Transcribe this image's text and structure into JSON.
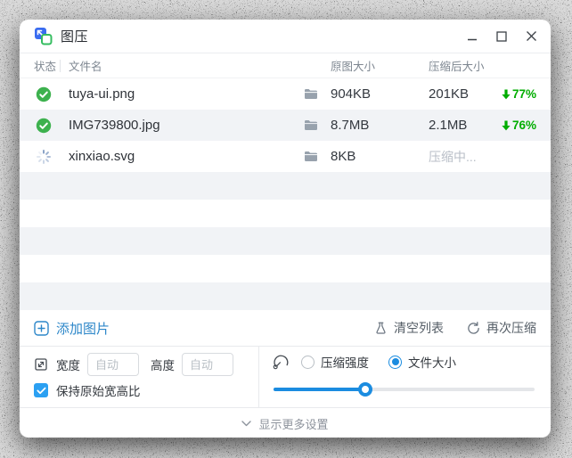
{
  "window": {
    "title": "图压"
  },
  "icons": {
    "app_logo": "overlapping-blue-green-squares",
    "minimize": "horizontal-line",
    "maximize": "square-outline",
    "close": "x-cross",
    "status_done": "green-check-circle",
    "status_processing": "segmented-spinner",
    "folder": "folder",
    "reduction": "green-down-arrow",
    "add": "plus-square",
    "clear": "flask",
    "recompress": "refresh-arrow",
    "resize": "square-diagonal-arrow",
    "gauge": "speedometer",
    "more": "chevron-down"
  },
  "table": {
    "columns": [
      "状态",
      "文件名",
      "原图大小",
      "压缩后大小"
    ],
    "rows": [
      {
        "status": "done",
        "filename": "tuya-ui.png",
        "original_size": "904KB",
        "compressed_size": "201KB",
        "reduction": "77%"
      },
      {
        "status": "done",
        "filename": "IMG739800.jpg",
        "original_size": "8.7MB",
        "compressed_size": "2.1MB",
        "reduction": "76%"
      },
      {
        "status": "compressing",
        "filename": "xinxiao.svg",
        "original_size": "8KB",
        "compressed_size": "压缩中...",
        "reduction": ""
      }
    ]
  },
  "toolbar": {
    "add_label": "添加图片",
    "clear_label": "清空列表",
    "recompress_label": "再次压缩"
  },
  "settings": {
    "width_label": "宽度",
    "height_label": "高度",
    "width_placeholder": "自动",
    "height_placeholder": "自动",
    "width_value": "",
    "height_value": "",
    "keep_ratio_label": "保持原始宽高比",
    "keep_ratio_checked": true,
    "mode_options": [
      "压缩强度",
      "文件大小"
    ],
    "mode_selected": "文件大小",
    "slider_percent": 35
  },
  "footer": {
    "more_label": "显示更多设置"
  },
  "colors": {
    "link_blue": "#2d87c9",
    "accent_blue": "#1b8ce0",
    "checkbox_blue": "#2ba0f2",
    "success_green": "#3db14e",
    "percent_green": "#00ad00",
    "processing_gray": "#b8bec7",
    "stripe_gray": "#f1f3f6"
  }
}
